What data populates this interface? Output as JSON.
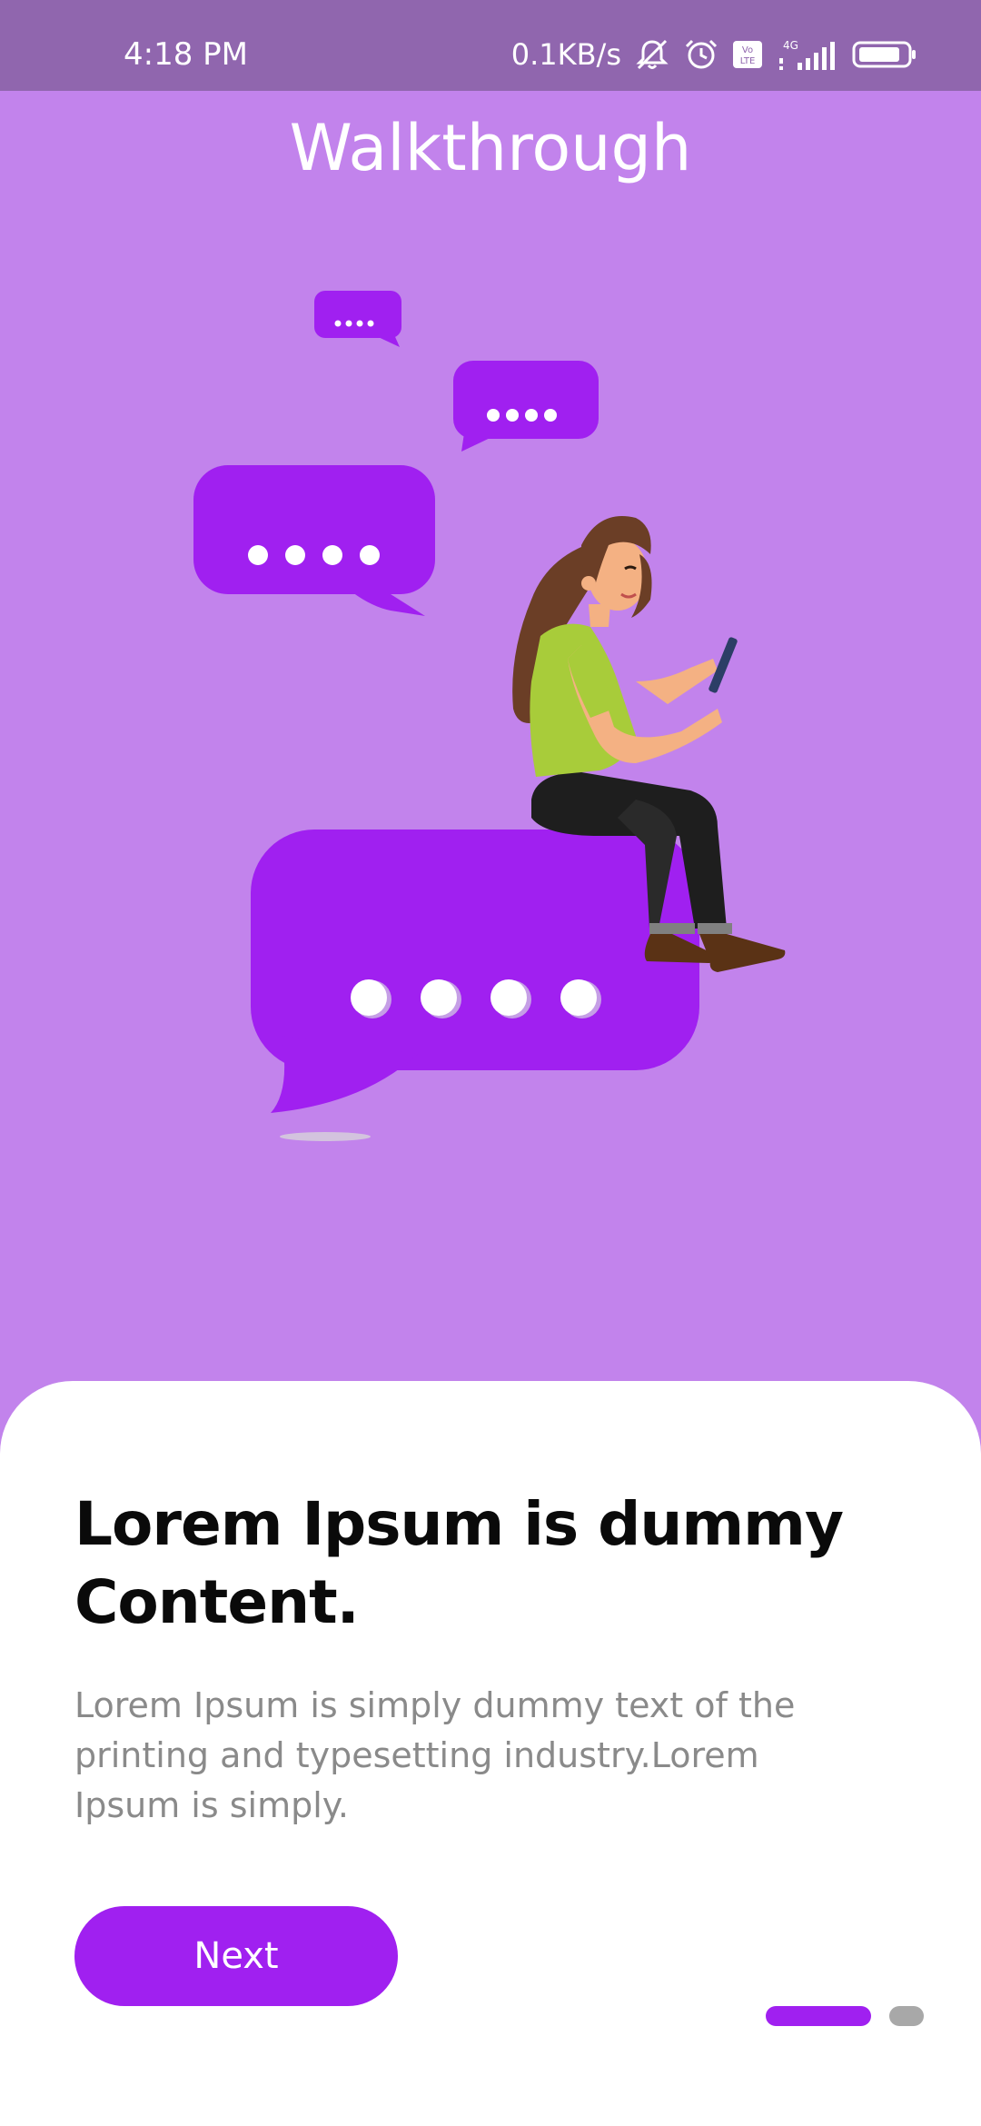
{
  "status_bar": {
    "time": "4:18 PM",
    "network_speed": "0.1KB/s",
    "icons": [
      "mute-icon",
      "alarm-icon",
      "volte-icon",
      "signal-4g-icon",
      "battery-icon"
    ],
    "network_type": "4G",
    "volte_label": "Vo LTE"
  },
  "header": {
    "title": "Walkthrough"
  },
  "illustration": {
    "name": "woman-sitting-on-chat-bubble-illustration",
    "accent_color": "#A020F0",
    "background_color": "#C283EC"
  },
  "card": {
    "heading": "Lorem Ipsum is dummy Content.",
    "body": "Lorem Ipsum is simply dummy text of the printing and typesetting industry.Lorem Ipsum is simply.",
    "next_label": "Next"
  },
  "pager": {
    "total_pages": 2,
    "current_page": 1,
    "active_color": "#A020F0",
    "inactive_color": "#A8A8A8"
  }
}
